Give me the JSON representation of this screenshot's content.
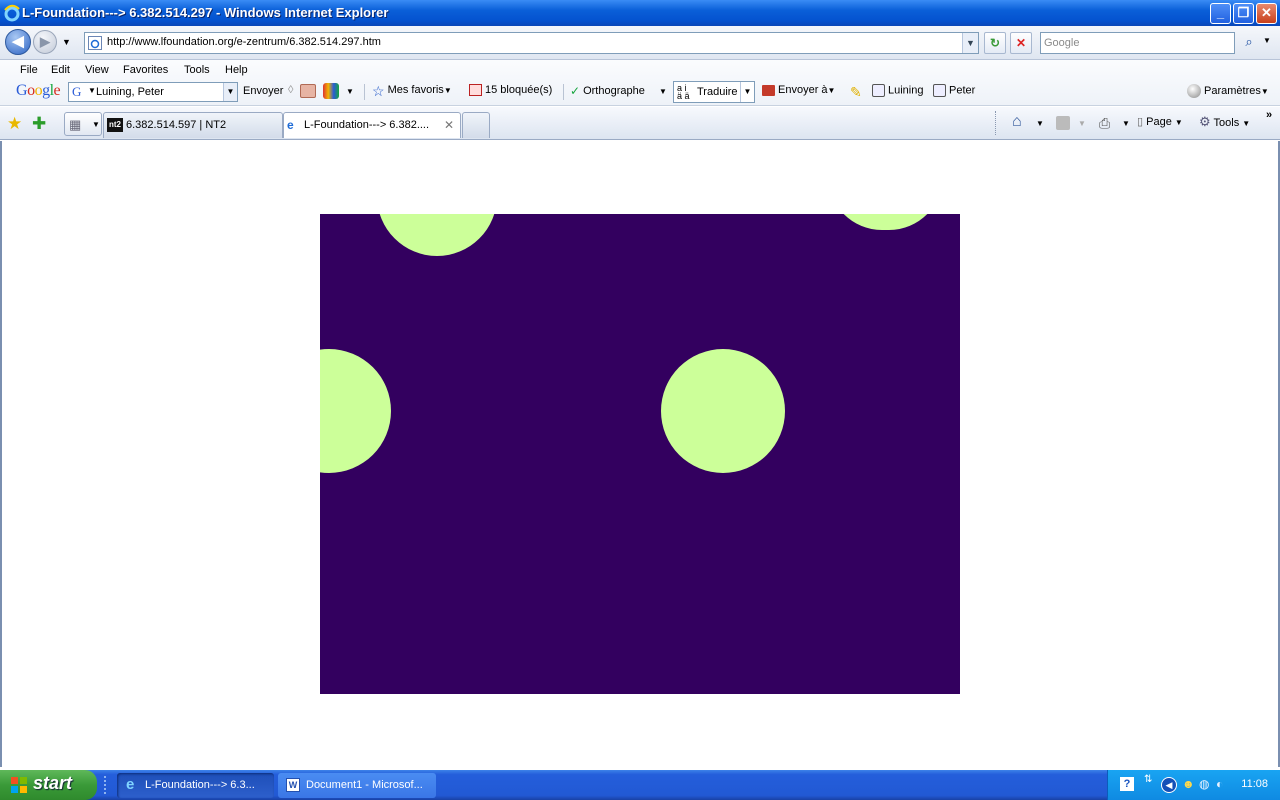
{
  "window": {
    "title": "L-Foundation---> 6.382.514.297 - Windows Internet Explorer",
    "buttons": [
      "minimize",
      "restore",
      "close"
    ]
  },
  "navbar": {
    "url": "http://www.lfoundation.org/e-zentrum/6.382.514.297.htm",
    "search_placeholder": "Google"
  },
  "menu": {
    "items": [
      "File",
      "Edit",
      "View",
      "Favorites",
      "Tools",
      "Help"
    ]
  },
  "google_toolbar": {
    "logo": "Google",
    "account": "Luining, Peter",
    "send": "Envoyer",
    "favorites": "Mes favoris",
    "blocked": "15 bloquée(s)",
    "spelling": "Orthographe",
    "translate": "Traduire",
    "send_to": "Envoyer à",
    "search1": "Luining",
    "search2": "Peter",
    "settings": "Paramètres"
  },
  "tabs": {
    "items": [
      {
        "label": "6.382.514.597 | NT2",
        "icon": "nt2-icon"
      },
      {
        "label": "L-Foundation---> 6.382....",
        "icon": "ie-icon"
      }
    ],
    "commands": {
      "page": "Page",
      "tools": "Tools"
    }
  },
  "canvas": {
    "background": "#33005f",
    "dot_color": "#ccff99"
  },
  "taskbar": {
    "start": "start",
    "items": [
      {
        "label": "L-Foundation---> 6.3..."
      },
      {
        "label": "Document1 - Microsof..."
      }
    ],
    "clock": "11:08"
  },
  "colors": {
    "title_bar": "#0a5fd8",
    "taskbar": "#245edb",
    "start_button": "#3a9a38"
  }
}
